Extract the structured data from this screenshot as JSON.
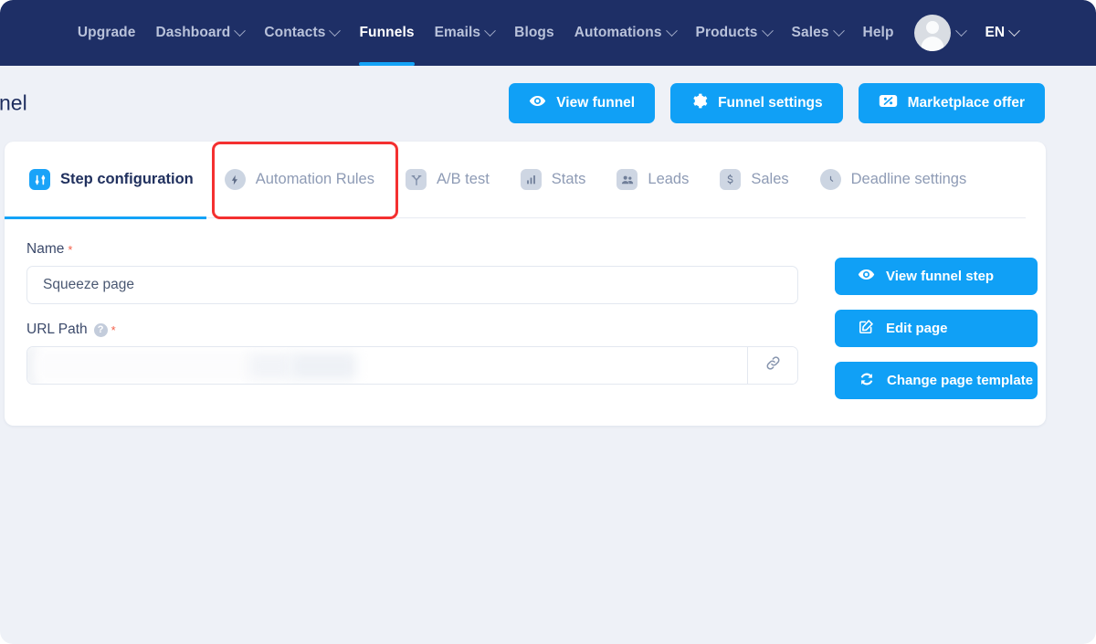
{
  "nav": {
    "items": [
      {
        "label": "Upgrade",
        "has_caret": false,
        "active": false
      },
      {
        "label": "Dashboard",
        "has_caret": true,
        "active": false
      },
      {
        "label": "Contacts",
        "has_caret": true,
        "active": false
      },
      {
        "label": "Funnels",
        "has_caret": false,
        "active": true
      },
      {
        "label": "Emails",
        "has_caret": true,
        "active": false
      },
      {
        "label": "Blogs",
        "has_caret": false,
        "active": false
      },
      {
        "label": "Automations",
        "has_caret": true,
        "active": false
      },
      {
        "label": "Products",
        "has_caret": true,
        "active": false
      },
      {
        "label": "Sales",
        "has_caret": true,
        "active": false
      },
      {
        "label": "Help",
        "has_caret": false,
        "active": false
      }
    ],
    "avatar_name": "avatar",
    "language": "EN"
  },
  "header": {
    "title": "nel",
    "buttons": [
      {
        "label": "View funnel",
        "icon": "eye-icon"
      },
      {
        "label": "Funnel settings",
        "icon": "gear-icon"
      },
      {
        "label": "Marketplace offer",
        "icon": "ticket-icon"
      }
    ]
  },
  "tabs": [
    {
      "label": "Step configuration",
      "icon": "sliders-icon",
      "active": true
    },
    {
      "label": "Automation Rules",
      "icon": "lightning-icon",
      "active": false
    },
    {
      "label": "A/B test",
      "icon": "split-icon",
      "active": false
    },
    {
      "label": "Stats",
      "icon": "bar-chart-icon",
      "active": false
    },
    {
      "label": "Leads",
      "icon": "people-icon",
      "active": false
    },
    {
      "label": "Sales",
      "icon": "dollar-icon",
      "active": false
    },
    {
      "label": "Deadline settings",
      "icon": "clock-icon",
      "active": false
    }
  ],
  "form": {
    "name_label": "Name",
    "name_value": "Squeeze page",
    "name_placeholder": "Squeeze page",
    "url_label": "URL Path",
    "url_value": "",
    "url_placeholder": "",
    "required_marker": "*",
    "help_marker": "?"
  },
  "side_buttons": [
    {
      "label": "View funnel step",
      "icon": "eye-icon"
    },
    {
      "label": "Edit page",
      "icon": "edit-icon"
    },
    {
      "label": "Change page template",
      "icon": "refresh-icon"
    }
  ],
  "annotation": {
    "target": "Automation Rules",
    "color": "#f43030"
  },
  "colors": {
    "navbar": "#1e2f66",
    "page_background": "#eef1f7",
    "accent_blue": "#10a0f6",
    "active_tab_underline": "#13a3f7",
    "highlight_red": "#f43030"
  }
}
